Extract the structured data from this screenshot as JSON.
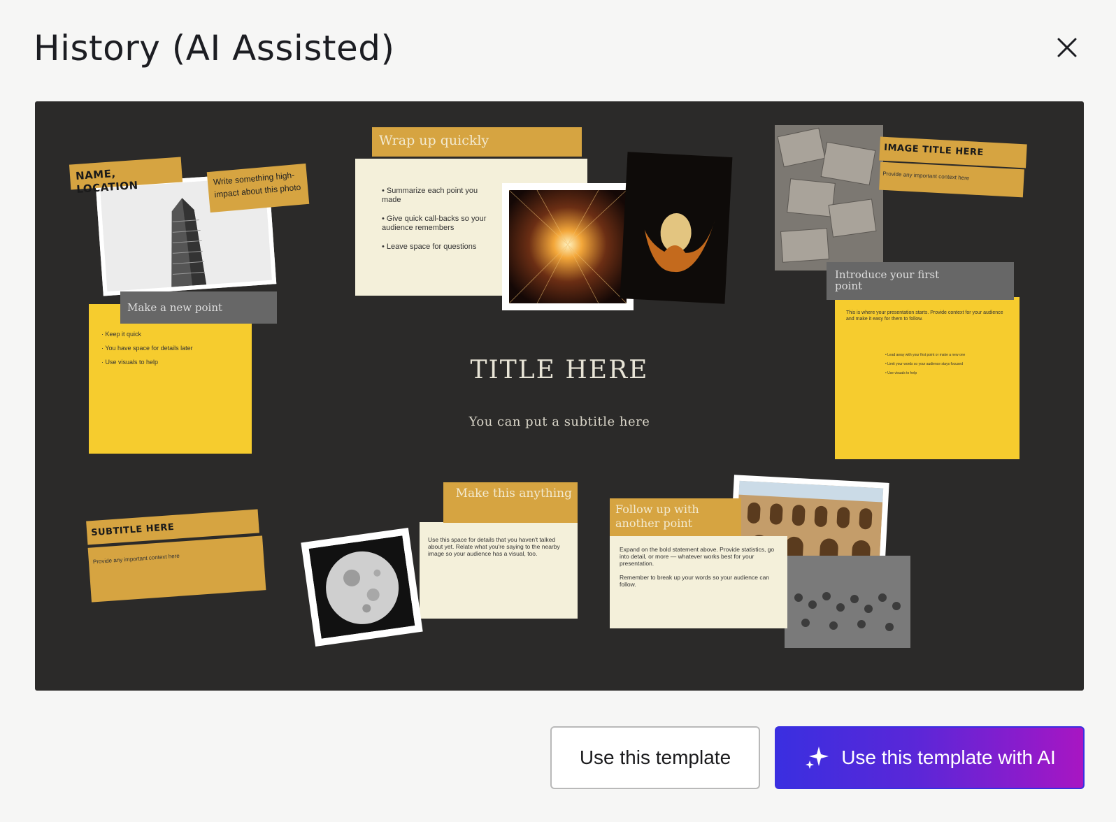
{
  "modal": {
    "title": "History (AI Assisted)",
    "close_icon": "close-icon"
  },
  "preview": {
    "title": "TITLE HERE",
    "subtitle": "You can put a subtitle here",
    "name_location": {
      "tag": "NAME, LOCATION",
      "note": "Write something high-impact about this photo"
    },
    "new_point": {
      "header": "Make a new point",
      "bullets": [
        "Keep it quick",
        "You have space for details later",
        "Use visuals to help"
      ]
    },
    "wrap_up": {
      "header": "Wrap up quickly",
      "bullets": [
        "Summarize each point you made",
        "Give quick call-backs so your audience remembers",
        "Leave space for questions"
      ]
    },
    "image_title": {
      "tag": "IMAGE TITLE HERE",
      "context": "Provide any important context here"
    },
    "first_point": {
      "header": "Introduce your first point",
      "body": "This is where your presentation starts. Provide context for your audience and make it easy for them to follow.",
      "bullets": [
        "Lead away with your first point or make a new one",
        "Limit your words so your audience stays focused",
        "Use visuals to help"
      ]
    },
    "subtitle_note": {
      "tag": "SUBTITLE HERE",
      "context": "Provide any important context here"
    },
    "make_anything": {
      "header": "Make this anything",
      "body": "Use this space for details that you haven't talked about yet. Relate what you're saying to the nearby image so your audience has a visual, too."
    },
    "follow_up": {
      "header": "Follow up with another point",
      "body1": "Expand on the bold statement above. Provide statistics, go into detail, or more — whatever works best for your presentation.",
      "body2": "Remember to break up your words so your audience can follow."
    }
  },
  "footer": {
    "use_template": "Use this template",
    "use_template_ai": "Use this template with AI",
    "ai_icon": "sparkle-icon"
  },
  "colors": {
    "board": "#2b2a29",
    "gold": "#d6a441",
    "yellow": "#f6cc2e",
    "cream": "#f4f0da",
    "ai_gradient_start": "#3a2fe0",
    "ai_gradient_end": "#a816c2"
  }
}
